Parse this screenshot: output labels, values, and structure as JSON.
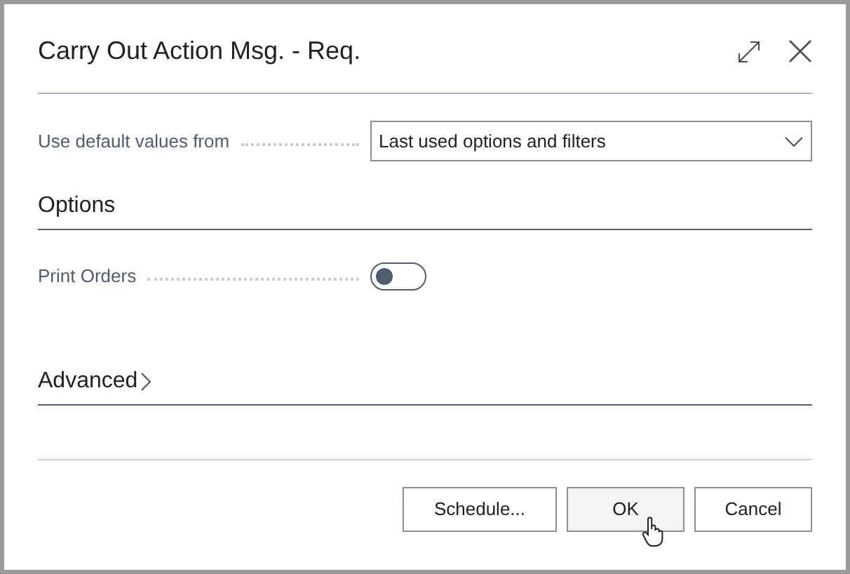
{
  "dialog": {
    "title": "Carry Out Action Msg. - Req."
  },
  "default_values": {
    "label": "Use default values from",
    "value": "Last used options and filters"
  },
  "options": {
    "heading": "Options",
    "fields": [
      {
        "label": "Print Orders",
        "kind": "toggle",
        "on": false
      }
    ]
  },
  "advanced": {
    "heading": "Advanced",
    "expanded": false
  },
  "buttons": [
    {
      "label": "Schedule...",
      "hovered": false
    },
    {
      "label": "OK",
      "hovered": true
    },
    {
      "label": "Cancel",
      "hovered": false
    }
  ]
}
